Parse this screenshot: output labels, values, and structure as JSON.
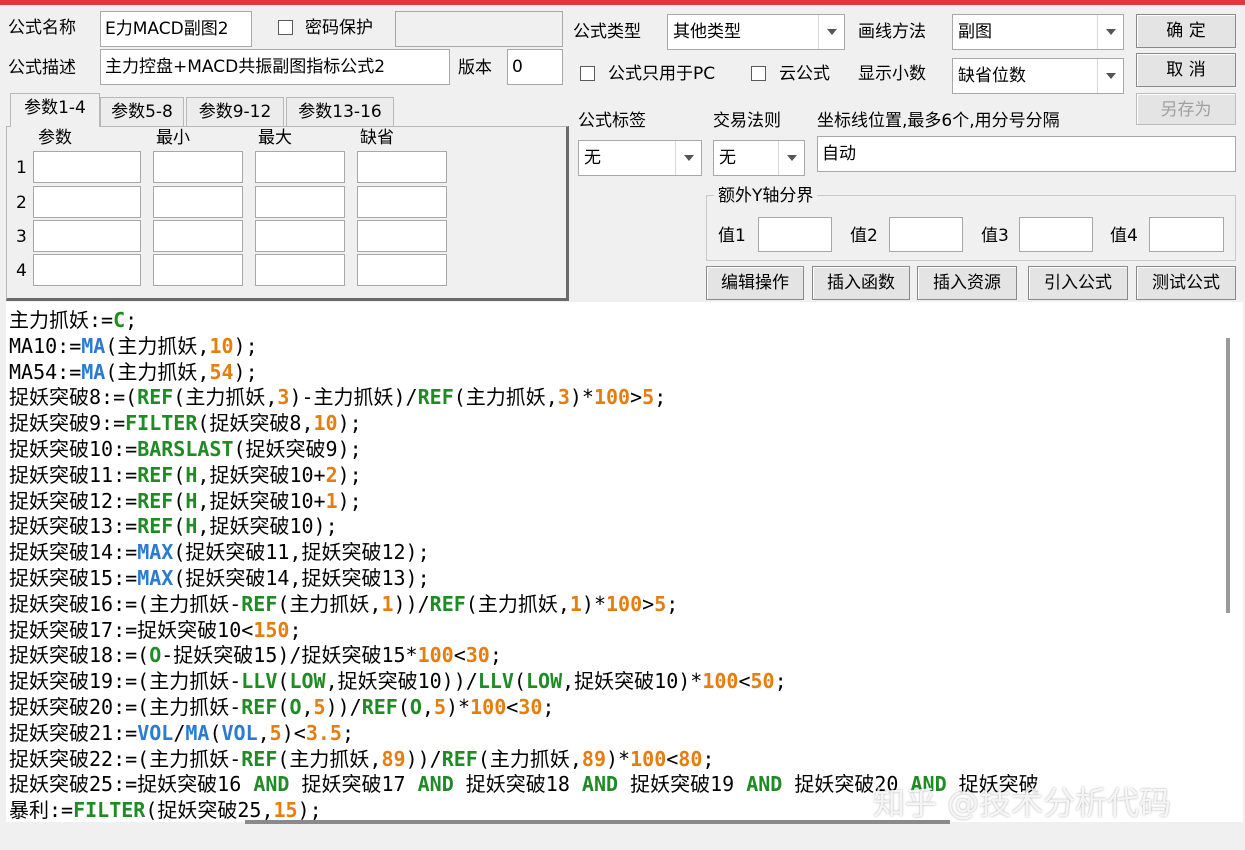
{
  "colors": {
    "title_strip": "#e0383d",
    "keyword": "#1f8b24",
    "function": "#2a7bd1",
    "number": "#e67e0f"
  },
  "form": {
    "name_label": "公式名称",
    "name_value": "E力MACD副图2",
    "password_label": "密码保护",
    "password_checked": false,
    "desc_label": "公式描述",
    "desc_value": "主力控盘+MACD共振副图指标公式2",
    "version_label": "版本",
    "version_value": "0",
    "type_label": "公式类型",
    "type_value": "其他类型",
    "draw_label": "画线方法",
    "draw_value": "副图",
    "pc_only_label": "公式只用于PC",
    "pc_only_checked": false,
    "cloud_label": "云公式",
    "cloud_checked": false,
    "decimals_label": "显示小数",
    "decimals_value": "缺省位数"
  },
  "buttons": {
    "ok": "确  定",
    "cancel": "取  消",
    "save_as": "另存为",
    "edit_ops": "编辑操作",
    "insert_func": "插入函数",
    "insert_res": "插入资源",
    "import_formula": "引入公式",
    "test_formula": "测试公式"
  },
  "tabs": [
    "参数1-4",
    "参数5-8",
    "参数9-12",
    "参数13-16"
  ],
  "params": {
    "headers": [
      "参数",
      "最小",
      "最大",
      "缺省"
    ],
    "rows": [
      "1",
      "2",
      "3",
      "4"
    ]
  },
  "tag": {
    "label": "公式标签",
    "value": "无"
  },
  "rule": {
    "label": "交易法则",
    "value": "无"
  },
  "coord": {
    "label": "坐标线位置,最多6个,用分号分隔",
    "value": "自动"
  },
  "yaxis": {
    "title": "额外Y轴分界",
    "labels": [
      "值1",
      "值2",
      "值3",
      "值4"
    ]
  },
  "code_lines": [
    [
      [
        "主力抓妖",
        ""
      ],
      [
        ":=",
        ""
      ],
      [
        "C",
        "k"
      ],
      [
        ";",
        ""
      ]
    ],
    [
      [
        "MA10",
        ""
      ],
      [
        ":=",
        ""
      ],
      [
        "MA",
        "f"
      ],
      [
        "(主力抓妖,",
        ""
      ],
      [
        "10",
        "n"
      ],
      [
        ");",
        ""
      ]
    ],
    [
      [
        "MA54",
        ""
      ],
      [
        ":=",
        ""
      ],
      [
        "MA",
        "f"
      ],
      [
        "(主力抓妖,",
        ""
      ],
      [
        "54",
        "n"
      ],
      [
        ");",
        ""
      ]
    ],
    [
      [
        "捉妖突破8",
        ""
      ],
      [
        ":=(",
        ""
      ],
      [
        "REF",
        "k"
      ],
      [
        "(主力抓妖,",
        ""
      ],
      [
        "3",
        "n"
      ],
      [
        ")-主力抓妖)/",
        ""
      ],
      [
        "REF",
        "k"
      ],
      [
        "(主力抓妖,",
        ""
      ],
      [
        "3",
        "n"
      ],
      [
        ")*",
        ""
      ],
      [
        "100",
        "n"
      ],
      [
        ">",
        ""
      ],
      [
        "5",
        "n"
      ],
      [
        ";",
        ""
      ]
    ],
    [
      [
        "捉妖突破9",
        ""
      ],
      [
        ":=",
        ""
      ],
      [
        "FILTER",
        "k"
      ],
      [
        "(捉妖突破8,",
        ""
      ],
      [
        "10",
        "n"
      ],
      [
        ");",
        ""
      ]
    ],
    [
      [
        "捉妖突破10",
        ""
      ],
      [
        ":=",
        ""
      ],
      [
        "BARSLAST",
        "k"
      ],
      [
        "(捉妖突破9);",
        ""
      ]
    ],
    [
      [
        "捉妖突破11",
        ""
      ],
      [
        ":=",
        ""
      ],
      [
        "REF",
        "k"
      ],
      [
        "(",
        ""
      ],
      [
        "H",
        "k"
      ],
      [
        ",捉妖突破10+",
        ""
      ],
      [
        "2",
        "n"
      ],
      [
        ");",
        ""
      ]
    ],
    [
      [
        "捉妖突破12",
        ""
      ],
      [
        ":=",
        ""
      ],
      [
        "REF",
        "k"
      ],
      [
        "(",
        ""
      ],
      [
        "H",
        "k"
      ],
      [
        ",捉妖突破10+",
        ""
      ],
      [
        "1",
        "n"
      ],
      [
        ");",
        ""
      ]
    ],
    [
      [
        "捉妖突破13",
        ""
      ],
      [
        ":=",
        ""
      ],
      [
        "REF",
        "k"
      ],
      [
        "(",
        ""
      ],
      [
        "H",
        "k"
      ],
      [
        ",捉妖突破10);",
        ""
      ]
    ],
    [
      [
        "捉妖突破14",
        ""
      ],
      [
        ":=",
        ""
      ],
      [
        "MAX",
        "f"
      ],
      [
        "(捉妖突破11,捉妖突破12);",
        ""
      ]
    ],
    [
      [
        "捉妖突破15",
        ""
      ],
      [
        ":=",
        ""
      ],
      [
        "MAX",
        "f"
      ],
      [
        "(捉妖突破14,捉妖突破13);",
        ""
      ]
    ],
    [
      [
        "捉妖突破16",
        ""
      ],
      [
        ":=(主力抓妖-",
        ""
      ],
      [
        "REF",
        "k"
      ],
      [
        "(主力抓妖,",
        ""
      ],
      [
        "1",
        "n"
      ],
      [
        "))/",
        ""
      ],
      [
        "REF",
        "k"
      ],
      [
        "(主力抓妖,",
        ""
      ],
      [
        "1",
        "n"
      ],
      [
        ")*",
        ""
      ],
      [
        "100",
        "n"
      ],
      [
        ">",
        ""
      ],
      [
        "5",
        "n"
      ],
      [
        ";",
        ""
      ]
    ],
    [
      [
        "捉妖突破17",
        ""
      ],
      [
        ":=捉妖突破10<",
        ""
      ],
      [
        "150",
        "n"
      ],
      [
        ";",
        ""
      ]
    ],
    [
      [
        "捉妖突破18",
        ""
      ],
      [
        ":=(",
        ""
      ],
      [
        "O",
        "k"
      ],
      [
        "-捉妖突破15)/捉妖突破15*",
        ""
      ],
      [
        "100",
        "n"
      ],
      [
        "<",
        ""
      ],
      [
        "30",
        "n"
      ],
      [
        ";",
        ""
      ]
    ],
    [
      [
        "捉妖突破19",
        ""
      ],
      [
        ":=(主力抓妖-",
        ""
      ],
      [
        "LLV",
        "k"
      ],
      [
        "(",
        ""
      ],
      [
        "LOW",
        "k"
      ],
      [
        ",捉妖突破10))/",
        ""
      ],
      [
        "LLV",
        "k"
      ],
      [
        "(",
        ""
      ],
      [
        "LOW",
        "k"
      ],
      [
        ",捉妖突破10)*",
        ""
      ],
      [
        "100",
        "n"
      ],
      [
        "<",
        ""
      ],
      [
        "50",
        "n"
      ],
      [
        ";",
        ""
      ]
    ],
    [
      [
        "捉妖突破20",
        ""
      ],
      [
        ":=(主力抓妖-",
        ""
      ],
      [
        "REF",
        "k"
      ],
      [
        "(",
        ""
      ],
      [
        "O",
        "k"
      ],
      [
        ",",
        ""
      ],
      [
        "5",
        "n"
      ],
      [
        "))/",
        ""
      ],
      [
        "REF",
        "k"
      ],
      [
        "(",
        ""
      ],
      [
        "O",
        "k"
      ],
      [
        ",",
        ""
      ],
      [
        "5",
        "n"
      ],
      [
        ")*",
        ""
      ],
      [
        "100",
        "n"
      ],
      [
        "<",
        ""
      ],
      [
        "30",
        "n"
      ],
      [
        ";",
        ""
      ]
    ],
    [
      [
        "捉妖突破21",
        ""
      ],
      [
        ":=",
        ""
      ],
      [
        "VOL",
        "f"
      ],
      [
        "/",
        ""
      ],
      [
        "MA",
        "f"
      ],
      [
        "(",
        ""
      ],
      [
        "VOL",
        "f"
      ],
      [
        ",",
        ""
      ],
      [
        "5",
        "n"
      ],
      [
        ")<",
        ""
      ],
      [
        "3.5",
        "n"
      ],
      [
        ";",
        ""
      ]
    ],
    [
      [
        "捉妖突破22",
        ""
      ],
      [
        ":=(主力抓妖-",
        ""
      ],
      [
        "REF",
        "k"
      ],
      [
        "(主力抓妖,",
        ""
      ],
      [
        "89",
        "n"
      ],
      [
        "))/",
        ""
      ],
      [
        "REF",
        "k"
      ],
      [
        "(主力抓妖,",
        ""
      ],
      [
        "89",
        "n"
      ],
      [
        ")*",
        ""
      ],
      [
        "100",
        "n"
      ],
      [
        "<",
        ""
      ],
      [
        "80",
        "n"
      ],
      [
        ";",
        ""
      ]
    ],
    [
      [
        "捉妖突破25",
        ""
      ],
      [
        ":=捉妖突破16 ",
        ""
      ],
      [
        "AND",
        "k"
      ],
      [
        " 捉妖突破17 ",
        ""
      ],
      [
        "AND",
        "k"
      ],
      [
        " 捉妖突破18 ",
        ""
      ],
      [
        "AND",
        "k"
      ],
      [
        " 捉妖突破19 ",
        ""
      ],
      [
        "AND",
        "k"
      ],
      [
        " 捉妖突破20 ",
        ""
      ],
      [
        "AND",
        "k"
      ],
      [
        " 捉妖突破",
        ""
      ]
    ],
    [
      [
        "暴利",
        ""
      ],
      [
        ":=",
        ""
      ],
      [
        "FILTER",
        "k"
      ],
      [
        "(捉妖突破25,",
        ""
      ],
      [
        "15",
        "n"
      ],
      [
        ");",
        ""
      ]
    ]
  ],
  "watermark": "知乎 @技术分析代码"
}
